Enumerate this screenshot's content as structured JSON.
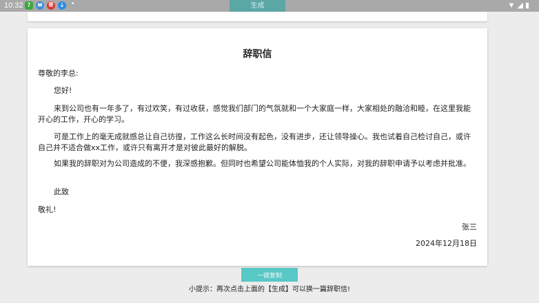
{
  "status_bar": {
    "time": "10:32",
    "notifications": [
      {
        "icon": "app-7-icon",
        "glyph": "7",
        "color": "#3aa83a"
      },
      {
        "icon": "chat-app-icon",
        "glyph": "✉",
        "color": "#3d8fd8"
      },
      {
        "icon": "red-app-icon",
        "glyph": "密",
        "color": "#d33"
      },
      {
        "icon": "download-icon",
        "glyph": "⇣",
        "color": "#2b8ce0"
      }
    ],
    "more": "•",
    "wifi_glyph": "▼",
    "signal_glyph": "◢",
    "battery_glyph": "▮"
  },
  "toolbar": {
    "generate_label": "生成"
  },
  "letter": {
    "title": "辞职信",
    "salutation": "尊敬的李总:",
    "greeting": "您好!",
    "paragraph1": "来到公司也有一年多了，有过欢笑，有过收获，感觉我们部门的气氛就和一个大家庭一样，大家相处的融洽和睦，在这里我能开心的工作，开心的学习。",
    "paragraph2": "可是工作上的毫无成就感总让自己彷徨，工作这么长时间没有起色，没有进步，还让领导操心。我也试着自己检讨自己，或许自己并不适合做xx工作，或许只有离开才是对彼此最好的解脱。",
    "paragraph3": "如果我的辞职对为公司造成的不便，我深感抱歉。但同时也希望公司能体恤我的个人实际，对我的辞职申请予以考虑并批准。",
    "closing1": "此致",
    "closing2": "敬礼!",
    "signature": "张三",
    "date": "2024年12月18日"
  },
  "actions": {
    "copy_label": "一键复制"
  },
  "tip": "小提示：再次点击上面的【生成】可以换一篇辞职信!"
}
